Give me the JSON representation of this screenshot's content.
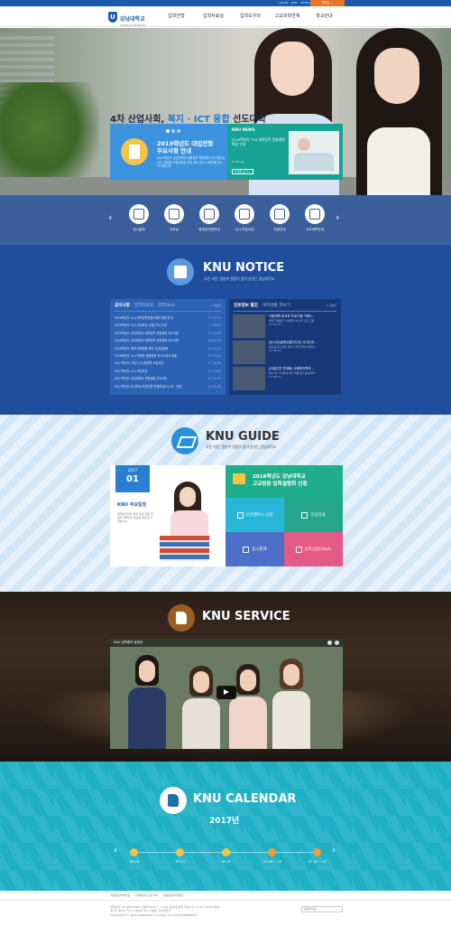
{
  "topbar": {
    "util_links": [
      "LOGIN",
      "JOIN",
      "SITEMAP",
      "강남대학교 바로가기"
    ],
    "admission_label": "입학홈 >"
  },
  "gnb": {
    "logo_name": "강남대학교",
    "logo_eng": "KANGNAM UNIVERSITY",
    "menu": [
      "입학전형",
      "입학자료실",
      "입학도우미",
      "고교대학연계",
      "학교안내"
    ]
  },
  "hero": {
    "title_pre": "4차 산업사회,",
    "title_accent": "복지 · ICT 융합",
    "title_post": "선도대학",
    "subtitle": "푸른 비전, 청춘의 열정이 살아 숨쉬는 강남대학교",
    "slide_title": "2019학년도 대입전형\n주요사항 안내",
    "slide_desc": "2019학년도 강남대학교 대학입학 전형계획 주요사항 입니다. 정확한 모집요강은 추후 확인 반드시 확인해 주시기 바랍니다.",
    "news_label": "KNU NEWS",
    "news_title": "2018학년도 수시 대학입학 전형계획 확정 안내",
    "news_date": "17.07.14",
    "news_more": "자세히 보기 >"
  },
  "quick": {
    "items": [
      "입시통계",
      "자료실",
      "동영상전형안내",
      "수시 모집요강",
      "전공안내",
      "고교대학연계"
    ]
  },
  "notice": {
    "title": "KNU NOTICE",
    "subtitle": "푸른 비전, 청춘의 열정이 살아 숨쉬는 강남대학교",
    "tabs": [
      "공지사항",
      "입학자료실",
      "입학Q&A"
    ],
    "more": "+ 더보기",
    "rows": [
      {
        "title": "2018학년도 수시 대학입학전형(계획) 확정 안내",
        "date": "17.07.14"
      },
      {
        "title": "2018학년도 수시 모집요강 수정(2차) 안내",
        "date": "17.06.01"
      },
      {
        "title": "2019학년도 강남대학교 대학입학 전형계획 주요사항",
        "date": "17.04.29"
      },
      {
        "title": "2018학년도 강남대학교 대학입학 전형계획 주요사항",
        "date": "16.04.29"
      },
      {
        "title": "2018학년도 예비 대학생을 위한 전공설명회",
        "date": "17.03.27"
      },
      {
        "title": "2018학년도 수시 학생부 종합전형 자기소개서 제출",
        "date": "17.03.02"
      },
      {
        "title": "2017학년도 2학기 수시편입학 모집요강",
        "date": "17.05.08"
      },
      {
        "title": "2017학년도 수시 모집요강",
        "date": "17.03.02"
      },
      {
        "title": "2017학년도 강남대학교 전형계획 주요사항",
        "date": "17.03.31"
      },
      {
        "title": "2017학년도 추가모집 모집인원 변경안내(01.24, 기준)",
        "date": "17.01.20"
      }
    ],
    "right_tabs": [
      "진로정보 별진",
      "대학생활 엿보기"
    ],
    "right_more": "+ 더보기",
    "photos": [
      {
        "title": "사랑대학 비교과 프로그램 \"예비...",
        "desc": "새로가게됐다 사랑대학 비교과 프로그램...",
        "date": "17.07.14"
      },
      {
        "title": "[당나라]설레주얼디자인] 사각디자...",
        "desc": "공모교디자인팀 정해 디자인학부 미술대...",
        "date": "17.06.29"
      },
      {
        "title": "[대결선전 연대회] 사회복지학부 ...",
        "desc": "제27회 사회복지학부 대결선전 종료하여...",
        "date": "17.06.29"
      }
    ]
  },
  "guide": {
    "title": "KNU GUIDE",
    "subtitle": "푸른 비전, 청춘의 열정이 살아 숨쉬는 강남대학교",
    "cal_year": "2017",
    "cal_month": "01",
    "cal_title": "KNU 주요일정",
    "cal_desc": "대학입학관의 입학 관련 전형 일정과 학부(과) 정보를 확인할 수 있습니다.",
    "visit_title": "2018학년도 강남대학교\n고교방문 입학설명회 신청",
    "buttons": [
      "오픈캠퍼스 신청",
      "전공안내",
      "입시통계",
      "입학상담(Q&A)"
    ]
  },
  "service": {
    "title": "KNU SERVICE",
    "video_title": "KNU 입학홍보 동영상"
  },
  "calendar": {
    "title": "KNU CALENDAR",
    "year": "2017년",
    "dates": [
      "09.18",
      "09.27",
      "09.30",
      "10.28 ~ 29",
      "07.01 ~ 07"
    ]
  },
  "footer": {
    "links": [
      "개인정보처리방침",
      "이메일무단수집거부",
      "영상정보처리방침"
    ],
    "address": "입학상담 031)280-3000 | 평일 09:00 ~ 17:00 (공휴일 휴무 점심시간 12:00~13:00 제외)\n경기도 용인시 기흥구 강남로 40 (구갈동) 강남대학교\nCOPYRIGHT © 2016 KANGNAM University. ALL RIGHT RESERVED",
    "select_label": "관련사이트"
  }
}
